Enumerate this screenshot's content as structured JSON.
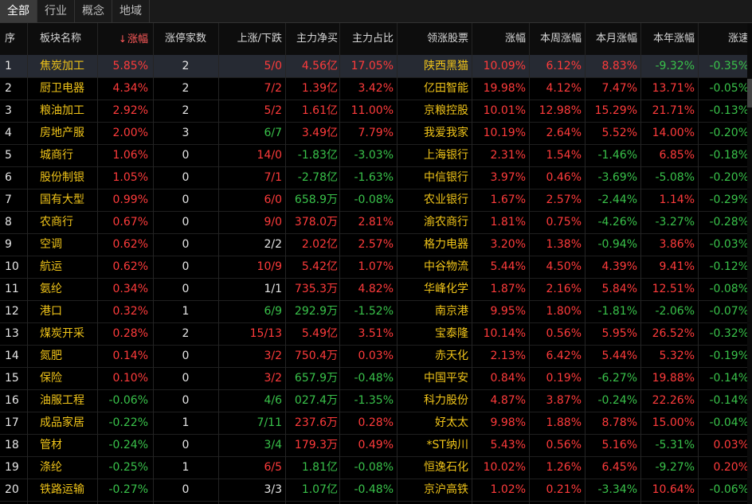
{
  "tabs": [
    "全部",
    "行业",
    "概念",
    "地域"
  ],
  "active_tab": 0,
  "colors": {
    "up": "#ff3b3b",
    "down": "#39c24a",
    "name": "#f0c419"
  },
  "headers": {
    "seq": "序",
    "name": "板块名称",
    "chg": "涨幅",
    "limit": "涨停家数",
    "updown": "上涨/下跌",
    "net": "主力净买",
    "ratio": "主力占比",
    "lead": "领涨股票",
    "lead_chg": "涨幅",
    "week": "本周涨幅",
    "month": "本月涨幅",
    "year": "本年涨幅",
    "speed": "涨速"
  },
  "rows": [
    {
      "seq": "1",
      "name": "焦炭加工",
      "chg": "5.85%",
      "limit": "2",
      "updown": "5/0",
      "net": "4.56亿",
      "ratio": "17.05%",
      "lead": "陕西黑猫",
      "lead_chg": "10.09%",
      "week": "6.12%",
      "month": "8.83%",
      "year": "-9.32%",
      "speed": "-0.35%"
    },
    {
      "seq": "2",
      "name": "厨卫电器",
      "chg": "4.34%",
      "limit": "2",
      "updown": "7/2",
      "net": "1.39亿",
      "ratio": "3.42%",
      "lead": "亿田智能",
      "lead_chg": "19.98%",
      "week": "4.12%",
      "month": "7.47%",
      "year": "13.71%",
      "speed": "-0.05%"
    },
    {
      "seq": "3",
      "name": "粮油加工",
      "chg": "2.92%",
      "limit": "2",
      "updown": "5/2",
      "net": "1.61亿",
      "ratio": "11.00%",
      "lead": "京粮控股",
      "lead_chg": "10.01%",
      "week": "12.98%",
      "month": "15.29%",
      "year": "21.71%",
      "speed": "-0.13%"
    },
    {
      "seq": "4",
      "name": "房地产服",
      "chg": "2.00%",
      "limit": "3",
      "updown": "6/7",
      "net": "3.49亿",
      "ratio": "7.79%",
      "lead": "我爱我家",
      "lead_chg": "10.19%",
      "week": "2.64%",
      "month": "5.52%",
      "year": "14.00%",
      "speed": "-0.20%"
    },
    {
      "seq": "5",
      "name": "城商行",
      "chg": "1.06%",
      "limit": "0",
      "updown": "14/0",
      "net": "-1.83亿",
      "ratio": "-3.03%",
      "lead": "上海银行",
      "lead_chg": "2.31%",
      "week": "1.54%",
      "month": "-1.46%",
      "year": "6.85%",
      "speed": "-0.18%"
    },
    {
      "seq": "6",
      "name": "股份制银",
      "chg": "1.05%",
      "limit": "0",
      "updown": "7/1",
      "net": "-2.78亿",
      "ratio": "-1.63%",
      "lead": "中信银行",
      "lead_chg": "3.97%",
      "week": "0.46%",
      "month": "-3.69%",
      "year": "-5.08%",
      "speed": "-0.20%"
    },
    {
      "seq": "7",
      "name": "国有大型",
      "chg": "0.99%",
      "limit": "0",
      "updown": "6/0",
      "net": "658.9万",
      "ratio": "-0.08%",
      "lead": "农业银行",
      "lead_chg": "1.67%",
      "week": "2.57%",
      "month": "-2.44%",
      "year": "1.14%",
      "speed": "-0.29%"
    },
    {
      "seq": "8",
      "name": "农商行",
      "chg": "0.67%",
      "limit": "0",
      "updown": "9/0",
      "net": "378.0万",
      "ratio": "2.81%",
      "lead": "渝农商行",
      "lead_chg": "1.81%",
      "week": "0.75%",
      "month": "-4.26%",
      "year": "-3.27%",
      "speed": "-0.28%"
    },
    {
      "seq": "9",
      "name": "空调",
      "chg": "0.62%",
      "limit": "0",
      "updown": "2/2",
      "net": "2.02亿",
      "ratio": "2.57%",
      "lead": "格力电器",
      "lead_chg": "3.20%",
      "week": "1.38%",
      "month": "-0.94%",
      "year": "3.86%",
      "speed": "-0.03%"
    },
    {
      "seq": "10",
      "name": "航运",
      "chg": "0.62%",
      "limit": "0",
      "updown": "10/9",
      "net": "5.42亿",
      "ratio": "1.07%",
      "lead": "中谷物流",
      "lead_chg": "5.44%",
      "week": "4.50%",
      "month": "4.39%",
      "year": "9.41%",
      "speed": "-0.12%"
    },
    {
      "seq": "11",
      "name": "氨纶",
      "chg": "0.34%",
      "limit": "0",
      "updown": "1/1",
      "net": "735.3万",
      "ratio": "4.82%",
      "lead": "华峰化学",
      "lead_chg": "1.87%",
      "week": "2.16%",
      "month": "5.84%",
      "year": "12.51%",
      "speed": "-0.08%"
    },
    {
      "seq": "12",
      "name": "港口",
      "chg": "0.32%",
      "limit": "1",
      "updown": "6/9",
      "net": "292.9万",
      "ratio": "-1.52%",
      "lead": "南京港",
      "lead_chg": "9.95%",
      "week": "1.80%",
      "month": "-1.81%",
      "year": "-2.06%",
      "speed": "-0.07%"
    },
    {
      "seq": "13",
      "name": "煤炭开采",
      "chg": "0.28%",
      "limit": "2",
      "updown": "15/13",
      "net": "5.49亿",
      "ratio": "3.51%",
      "lead": "宝泰隆",
      "lead_chg": "10.14%",
      "week": "0.56%",
      "month": "5.95%",
      "year": "26.52%",
      "speed": "-0.32%"
    },
    {
      "seq": "14",
      "name": "氮肥",
      "chg": "0.14%",
      "limit": "0",
      "updown": "3/2",
      "net": "750.4万",
      "ratio": "0.03%",
      "lead": "赤天化",
      "lead_chg": "2.13%",
      "week": "6.42%",
      "month": "5.44%",
      "year": "5.32%",
      "speed": "-0.19%"
    },
    {
      "seq": "15",
      "name": "保险",
      "chg": "0.10%",
      "limit": "0",
      "updown": "3/2",
      "net": "657.9万",
      "ratio": "-0.48%",
      "lead": "中国平安",
      "lead_chg": "0.84%",
      "week": "0.19%",
      "month": "-6.27%",
      "year": "19.88%",
      "speed": "-0.14%"
    },
    {
      "seq": "16",
      "name": "油服工程",
      "chg": "-0.06%",
      "limit": "0",
      "updown": "4/6",
      "net": "027.4万",
      "ratio": "-1.35%",
      "lead": "科力股份",
      "lead_chg": "4.87%",
      "week": "3.87%",
      "month": "-0.24%",
      "year": "22.26%",
      "speed": "-0.14%"
    },
    {
      "seq": "17",
      "name": "成品家居",
      "chg": "-0.22%",
      "limit": "1",
      "updown": "7/11",
      "net": "237.6万",
      "ratio": "0.28%",
      "lead": "好太太",
      "lead_chg": "9.98%",
      "week": "1.88%",
      "month": "8.78%",
      "year": "15.00%",
      "speed": "-0.04%"
    },
    {
      "seq": "18",
      "name": "管材",
      "chg": "-0.24%",
      "limit": "0",
      "updown": "3/4",
      "net": "179.3万",
      "ratio": "0.49%",
      "lead": "*ST纳川",
      "lead_chg": "5.43%",
      "week": "0.56%",
      "month": "5.16%",
      "year": "-5.31%",
      "speed": "0.03%"
    },
    {
      "seq": "19",
      "name": "涤纶",
      "chg": "-0.25%",
      "limit": "1",
      "updown": "6/5",
      "net": "1.81亿",
      "ratio": "-0.08%",
      "lead": "恒逸石化",
      "lead_chg": "10.02%",
      "week": "1.26%",
      "month": "6.45%",
      "year": "-9.27%",
      "speed": "0.20%"
    },
    {
      "seq": "20",
      "name": "铁路运输",
      "chg": "-0.27%",
      "limit": "0",
      "updown": "3/3",
      "net": "1.07亿",
      "ratio": "-0.48%",
      "lead": "京沪高铁",
      "lead_chg": "1.02%",
      "week": "0.21%",
      "month": "-3.34%",
      "year": "10.64%",
      "speed": "-0.06%"
    }
  ]
}
